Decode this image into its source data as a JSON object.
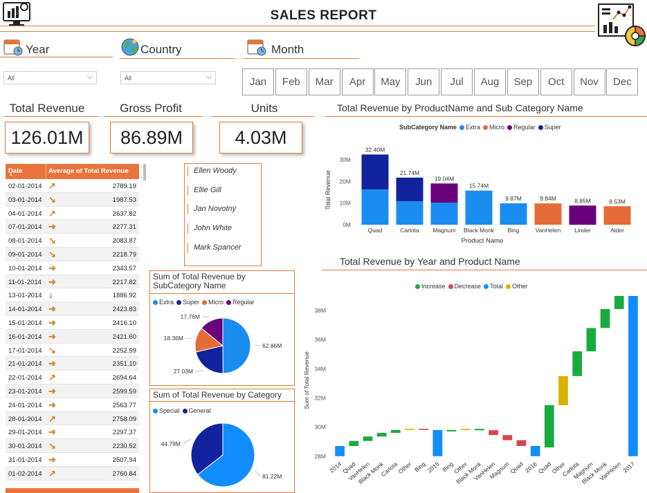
{
  "header": {
    "title": "SALES REPORT",
    "logo_icon": "dashboard-monitor-icon",
    "report_icon": "analytics-report-icon"
  },
  "slicers": {
    "year": {
      "label": "Year",
      "value": "All",
      "icon": "calendar-icon"
    },
    "country": {
      "label": "Country",
      "value": "All",
      "icon": "globe-icon"
    },
    "month": {
      "label": "Month",
      "icon": "calendar-icon",
      "options": [
        "Jan",
        "Feb",
        "Mar",
        "Apr",
        "May",
        "Jun",
        "Jul",
        "Aug",
        "Sep",
        "Oct",
        "Nov",
        "Dec"
      ]
    }
  },
  "kpis": {
    "revenue": {
      "label": "Total Revenue",
      "value": "126.01M"
    },
    "profit": {
      "label": "Gross Profit",
      "value": "86.89M"
    },
    "units": {
      "label": "Units",
      "value": "4.03M"
    }
  },
  "table": {
    "col_date": "Date",
    "col_avg": "Average of Total Revenue",
    "sort_indicator": "▲",
    "rows": [
      {
        "date": "02-01-2014",
        "trend": "up",
        "value": "2789.19"
      },
      {
        "date": "03-01-2014",
        "trend": "down",
        "value": "1987.53"
      },
      {
        "date": "04-01-2014",
        "trend": "up",
        "value": "2637.82"
      },
      {
        "date": "07-01-2014",
        "trend": "flat",
        "value": "2277.31"
      },
      {
        "date": "08-01-2014",
        "trend": "down",
        "value": "2083.87"
      },
      {
        "date": "09-01-2014",
        "trend": "down",
        "value": "2218.79"
      },
      {
        "date": "10-01-2014",
        "trend": "flat",
        "value": "2343.57"
      },
      {
        "date": "11-01-2014",
        "trend": "flat",
        "value": "2217.82"
      },
      {
        "date": "13-01-2014",
        "trend": "bigdown",
        "value": "1886.92"
      },
      {
        "date": "14-01-2014",
        "trend": "flat",
        "value": "2423.83"
      },
      {
        "date": "15-01-2014",
        "trend": "flat",
        "value": "2416.10"
      },
      {
        "date": "16-01-2014",
        "trend": "flat",
        "value": "2421.60"
      },
      {
        "date": "17-01-2014",
        "trend": "down",
        "value": "2252.59"
      },
      {
        "date": "21-01-2014",
        "trend": "flat",
        "value": "2351.10"
      },
      {
        "date": "22-01-2014",
        "trend": "up",
        "value": "2694.64"
      },
      {
        "date": "23-01-2014",
        "trend": "flat",
        "value": "2599.59"
      },
      {
        "date": "24-01-2014",
        "trend": "flat",
        "value": "2563.77"
      },
      {
        "date": "28-01-2014",
        "trend": "up",
        "value": "2758.09"
      },
      {
        "date": "29-01-2014",
        "trend": "flat",
        "value": "2297.37"
      },
      {
        "date": "30-01-2014",
        "trend": "down",
        "value": "2230.52"
      },
      {
        "date": "31-01-2014",
        "trend": "flat",
        "value": "2507.94"
      },
      {
        "date": "01-02-2014",
        "trend": "up",
        "value": "2760.84"
      }
    ]
  },
  "salespeople": [
    "Ellen Woody",
    "Ellie Gill",
    "Jan Novotny",
    "John White",
    "Mark Spancer"
  ],
  "colors": {
    "accent": "#e07a3a",
    "extra": "#1a8cf0",
    "super": "#12239e",
    "micro": "#e66c37",
    "regular": "#6b007b",
    "increase": "#1aab40",
    "decrease": "#d64550",
    "total": "#118dff",
    "other": "#d9b300"
  },
  "charts": {
    "bar": {
      "title": "Total Revenue by ProductName and Sub Category Name",
      "legend_title": "SubCategory Name",
      "legend": [
        "Extra",
        "Micro",
        "Regular",
        "Super"
      ],
      "xlabel": "Product Name",
      "ylabel": "Total Revenue",
      "y_ticks": [
        "30M",
        "20M",
        "10M",
        "0M"
      ]
    },
    "pie1": {
      "title": "Sum of Total Revenue by SubCategory Name",
      "legend": [
        "Extra",
        "Super",
        "Micro",
        "Regular"
      ]
    },
    "pie2": {
      "title": "Sum of Total Revenue by Category",
      "legend": [
        "Special",
        "General"
      ]
    },
    "waterfall": {
      "title": "Total Revenue by Year and Product Name",
      "legend": [
        "Increase",
        "Decrease",
        "Total",
        "Other"
      ],
      "ylabel": "Sum of Total Revenue",
      "y_ticks": [
        "38M",
        "36M",
        "34M",
        "32M",
        "30M",
        "28M"
      ]
    }
  },
  "chart_data": [
    {
      "type": "bar",
      "title": "Total Revenue by ProductName and Sub Category Name",
      "xlabel": "Product Name",
      "ylabel": "Total Revenue",
      "ylim": [
        0,
        35
      ],
      "categories": [
        "Quad",
        "Carlota",
        "Magnum",
        "Black Monk",
        "Bing",
        "VanHelen",
        "Linder",
        "Alder"
      ],
      "totals_labels": [
        "32.40M",
        "21.74M",
        "19.04M",
        "15.74M",
        "9.87M",
        "9.84M",
        "8.85M",
        "8.53M"
      ],
      "series": [
        {
          "name": "Extra",
          "values": [
            16.3,
            10.8,
            10.2,
            15.74,
            9.87,
            0,
            0,
            0
          ]
        },
        {
          "name": "Micro",
          "values": [
            0,
            0,
            0,
            0,
            0,
            9.84,
            0,
            8.53
          ]
        },
        {
          "name": "Regular",
          "values": [
            0,
            0,
            8.84,
            0,
            0,
            0,
            8.85,
            0
          ]
        },
        {
          "name": "Super",
          "values": [
            16.1,
            10.94,
            0,
            0,
            0,
            0,
            0,
            0
          ]
        }
      ]
    },
    {
      "type": "pie",
      "title": "Sum of Total Revenue by SubCategory Name",
      "labels": [
        "Extra",
        "Super",
        "Micro",
        "Regular"
      ],
      "values": [
        62.86,
        27.03,
        18.36,
        17.76
      ],
      "value_labels": [
        "62.86M",
        "27.03M",
        "18.36M",
        "17.76M"
      ]
    },
    {
      "type": "pie",
      "title": "Sum of Total Revenue by Category",
      "labels": [
        "Special",
        "General"
      ],
      "values": [
        81.22,
        44.79
      ],
      "value_labels": [
        "81.22M",
        "44.79M"
      ]
    },
    {
      "type": "bar",
      "subtype": "waterfall",
      "title": "Total Revenue by Year and Product Name",
      "ylabel": "Sum of Total Revenue",
      "ylim": [
        27.8,
        39
      ],
      "steps": [
        {
          "label": "2014",
          "kind": "total",
          "start": 28.0,
          "end": 28.7
        },
        {
          "label": "Quad",
          "kind": "increase",
          "start": 28.7,
          "end": 29.05
        },
        {
          "label": "VanHelen",
          "kind": "increase",
          "start": 29.05,
          "end": 29.35
        },
        {
          "label": "Black Monk",
          "kind": "increase",
          "start": 29.35,
          "end": 29.6
        },
        {
          "label": "Carlota",
          "kind": "increase",
          "start": 29.6,
          "end": 29.8
        },
        {
          "label": "Other",
          "kind": "other",
          "start": 29.8,
          "end": 29.88
        },
        {
          "label": "Bing",
          "kind": "decrease",
          "start": 29.88,
          "end": 29.8
        },
        {
          "label": "2015",
          "kind": "total",
          "start": 28.0,
          "end": 29.8
        },
        {
          "label": "Bing",
          "kind": "increase",
          "start": 29.7,
          "end": 29.8
        },
        {
          "label": "Other",
          "kind": "other",
          "start": 29.8,
          "end": 29.88
        },
        {
          "label": "Black Monk",
          "kind": "increase",
          "start": 29.78,
          "end": 29.88
        },
        {
          "label": "VanHelen",
          "kind": "decrease",
          "start": 29.78,
          "end": 29.45
        },
        {
          "label": "Magnum",
          "kind": "decrease",
          "start": 29.45,
          "end": 29.1
        },
        {
          "label": "Quad",
          "kind": "decrease",
          "start": 29.1,
          "end": 28.7
        },
        {
          "label": "2016",
          "kind": "total",
          "start": 28.0,
          "end": 28.7
        },
        {
          "label": "Quad",
          "kind": "increase",
          "start": 28.6,
          "end": 31.5
        },
        {
          "label": "Other",
          "kind": "other",
          "start": 31.5,
          "end": 33.5
        },
        {
          "label": "Carlota",
          "kind": "increase",
          "start": 33.5,
          "end": 35.2
        },
        {
          "label": "Magnum",
          "kind": "increase",
          "start": 35.2,
          "end": 36.8
        },
        {
          "label": "Black Monk",
          "kind": "increase",
          "start": 36.8,
          "end": 38.1
        },
        {
          "label": "VanHelen",
          "kind": "increase",
          "start": 38.1,
          "end": 39.0
        },
        {
          "label": "2017",
          "kind": "total",
          "start": 28.0,
          "end": 39.0
        }
      ]
    }
  ]
}
